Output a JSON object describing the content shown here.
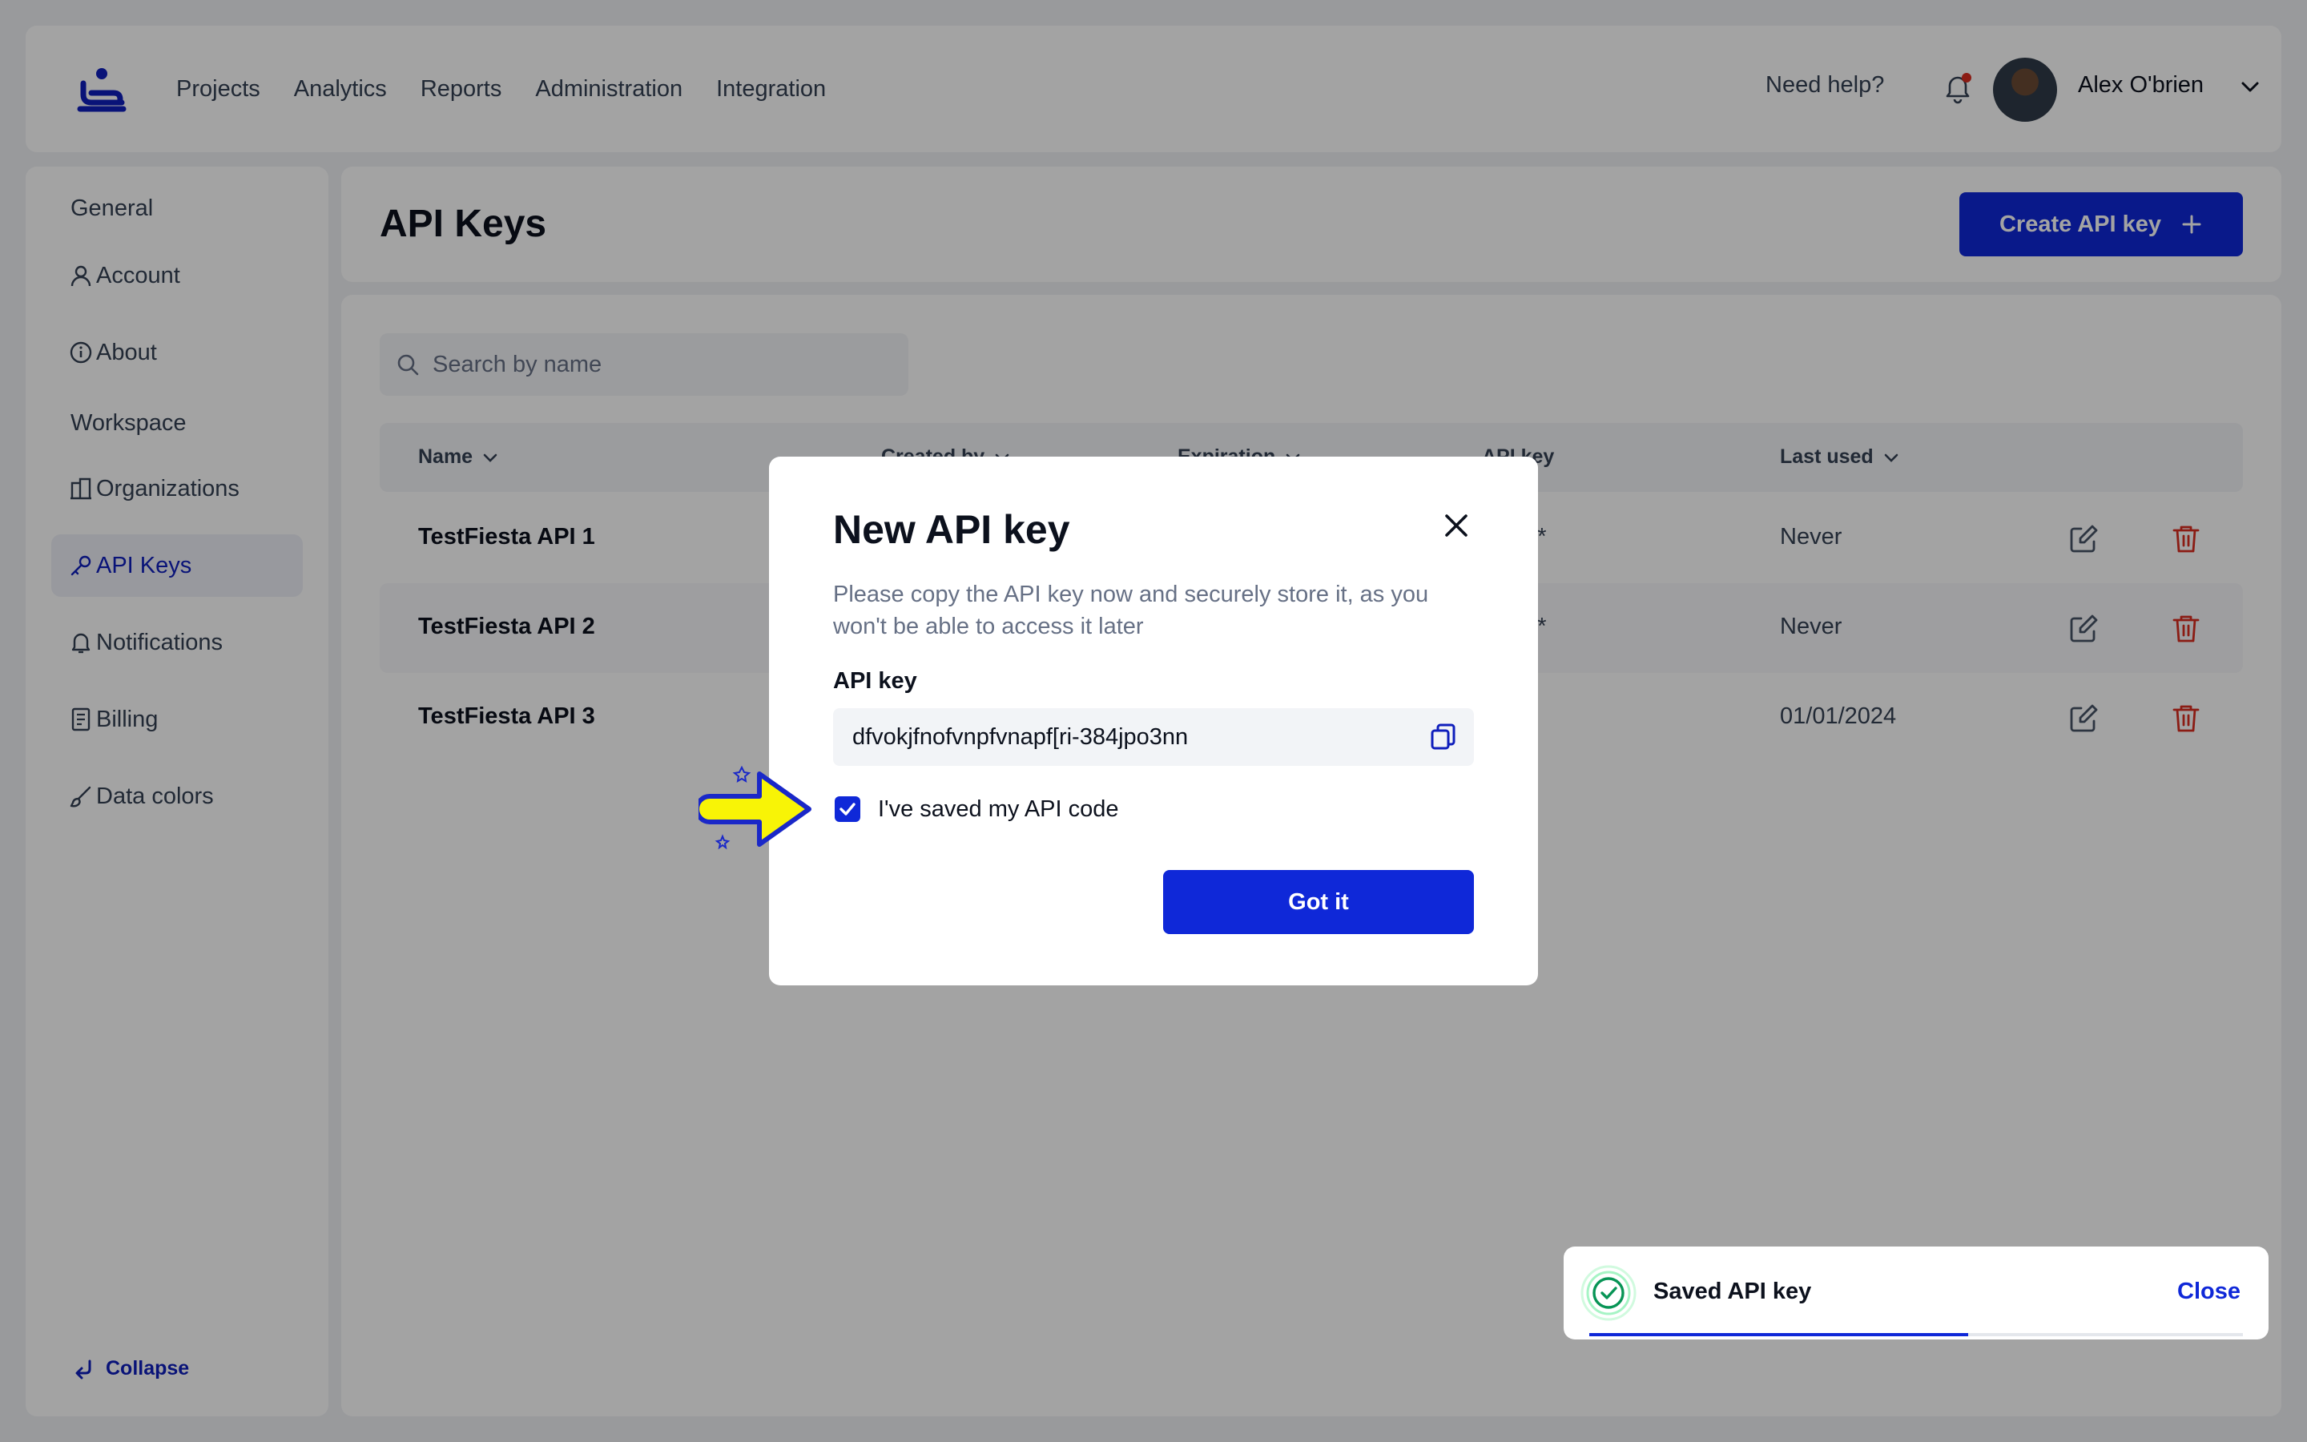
{
  "topbar": {
    "nav": [
      "Projects",
      "Analytics",
      "Reports",
      "Administration",
      "Integration"
    ],
    "help": "Need help?",
    "user_name": "Alex O'brien"
  },
  "sidebar": {
    "general_label": "General",
    "workspace_label": "Workspace",
    "items": [
      {
        "label": "Account",
        "icon": "user-icon"
      },
      {
        "label": "About",
        "icon": "info-icon"
      },
      {
        "label": "Organizations",
        "icon": "building-icon"
      },
      {
        "label": "API Keys",
        "icon": "key-icon",
        "active": true
      },
      {
        "label": "Notifications",
        "icon": "bell-icon"
      },
      {
        "label": "Billing",
        "icon": "document-icon"
      },
      {
        "label": "Data colors",
        "icon": "brush-icon"
      }
    ],
    "collapse": "Collapse"
  },
  "page": {
    "title": "API Keys",
    "create_button": "Create API key"
  },
  "search": {
    "placeholder": "Search by name"
  },
  "table": {
    "columns": [
      "Name",
      "Created by",
      "Expiration",
      "API key",
      "Last used"
    ],
    "rows": [
      {
        "name": "TestFiesta API 1",
        "api_key": "**",
        "last_used": "Never"
      },
      {
        "name": "TestFiesta API 2",
        "api_key": "**",
        "last_used": "Never"
      },
      {
        "name": "TestFiesta API 3",
        "api_key": "*",
        "last_used": "01/01/2024"
      }
    ]
  },
  "modal": {
    "title": "New API key",
    "description": "Please copy the API key now and securely store it, as you won't be able to access it later",
    "key_label": "API key",
    "key_value": "dfvokjfnofvnpfvnapf[ri-384jpo3nn",
    "checkbox_label": "I've saved my API code",
    "checkbox_checked": true,
    "confirm_button": "Got it"
  },
  "toast": {
    "message": "Saved API key",
    "close": "Close",
    "progress": 0.58
  },
  "colors": {
    "accent": "#0f28d8",
    "danger": "#d92d20",
    "success": "#079455",
    "highlight_arrow": "#f8f406"
  }
}
